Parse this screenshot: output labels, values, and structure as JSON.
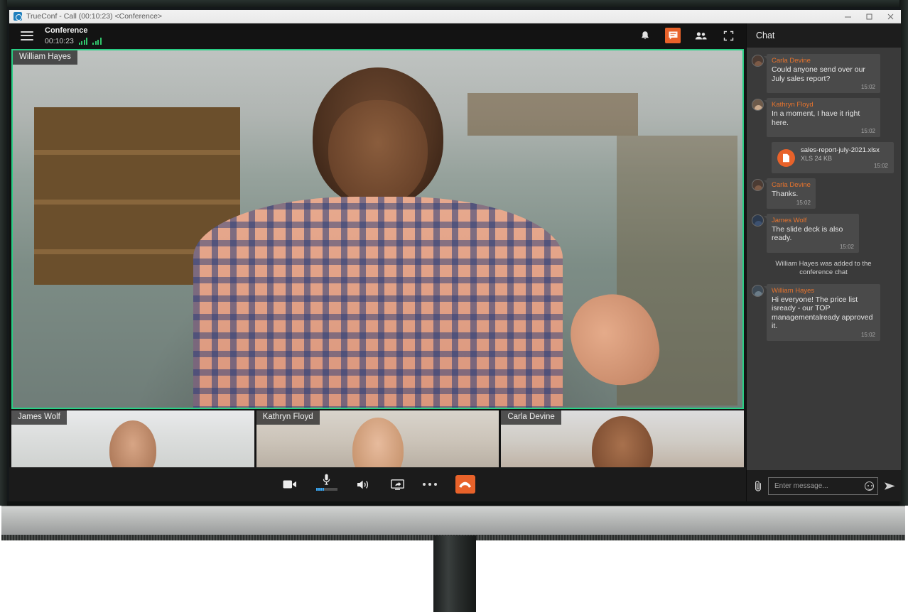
{
  "window": {
    "titlebar_text": "TrueConf - Call (00:10:23) <Conference>",
    "app_icon": "trueconf-icon",
    "minimize": "minimize-icon",
    "maximize": "maximize-icon",
    "close": "close-icon"
  },
  "conference": {
    "menu_icon": "hamburger-menu-icon",
    "title": "Conference",
    "timer": "00:10:23",
    "signal_icons": [
      "signal-bars-icon",
      "signal-bars-icon"
    ],
    "actions": [
      {
        "name": "notifications-bell-icon",
        "label": "Notifications",
        "active": false
      },
      {
        "name": "chat-icon",
        "label": "Chat",
        "active": true
      },
      {
        "name": "participants-icon",
        "label": "Participants",
        "active": false
      },
      {
        "name": "fullscreen-icon",
        "label": "Fullscreen",
        "active": false
      }
    ],
    "active_speaker": {
      "name": "William Hayes",
      "border_color": "#29cf85"
    },
    "thumbnails": [
      {
        "name": "James Wolf"
      },
      {
        "name": "Kathryn Floyd"
      },
      {
        "name": "Carla Devine"
      }
    ]
  },
  "controls": [
    {
      "name": "camera-icon",
      "label": "Camera"
    },
    {
      "name": "microphone-icon",
      "label": "Microphone"
    },
    {
      "name": "speaker-icon",
      "label": "Speaker"
    },
    {
      "name": "screen-share-icon",
      "label": "Share screen"
    },
    {
      "name": "more-options-icon",
      "label": "More"
    },
    {
      "name": "hangup-icon",
      "label": "End call"
    }
  ],
  "colors": {
    "accent_orange": "#e8622a",
    "accent_green": "#29cf85",
    "chat_bg": "#3a3a3a",
    "bubble_bg": "#4a4a4a",
    "sender_name": "#e8742d"
  },
  "chat": {
    "title": "Chat",
    "messages": [
      {
        "type": "text",
        "sender": "Carla Devine",
        "avatar": "a-carla",
        "text": "Could anyone send over our  July sales report?",
        "time": "15:02"
      },
      {
        "type": "text",
        "sender": "Kathryn Floyd",
        "avatar": "a-kathryn",
        "text": "In a moment, I have it right here.",
        "time": "15:02"
      },
      {
        "type": "file",
        "file_name": "sales-report-july-2021.xlsx",
        "file_size": "XLS 24 KB",
        "time": "15:02",
        "icon": "file-icon"
      },
      {
        "type": "text",
        "sender": "Carla Devine",
        "avatar": "a-carla",
        "text": "Thanks.",
        "time": "15:02"
      },
      {
        "type": "text",
        "sender": "James Wolf",
        "avatar": "a-james",
        "text": "The slide deck is also ready.",
        "time": "15:02"
      },
      {
        "type": "system",
        "text": "William Hayes was added to the conference chat"
      },
      {
        "type": "text",
        "sender": "William Hayes",
        "avatar": "a-william",
        "text": "Hi everyone! The price list isready - our TOP managementalready approved it.",
        "time": "15:02"
      }
    ],
    "input": {
      "attach_icon": "paperclip-icon",
      "placeholder": "Enter message...",
      "value": "",
      "emoji_icon": "smiley-icon",
      "send_icon": "send-icon"
    }
  }
}
